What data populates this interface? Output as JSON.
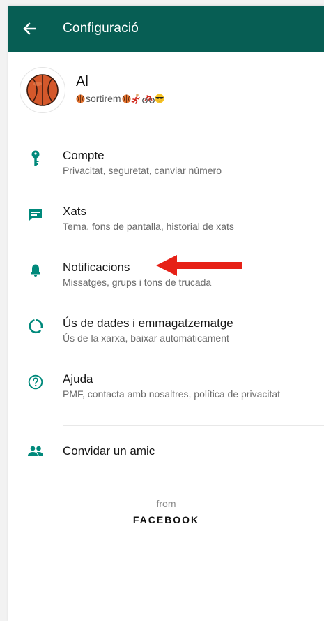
{
  "appbar": {
    "title": "Configuració",
    "color": "#075e54"
  },
  "profile": {
    "name": "Al",
    "status_text": "sortirem",
    "avatar_icon": "basketball-icon"
  },
  "menu": [
    {
      "title": "Compte",
      "subtitle": "Privacitat, seguretat, canviar número",
      "icon": "key-icon"
    },
    {
      "title": "Xats",
      "subtitle": "Tema, fons de pantalla, historial de xats",
      "icon": "chat-icon"
    },
    {
      "title": "Notificacions",
      "subtitle": "Missatges, grups i tons de trucada",
      "icon": "bell-icon"
    },
    {
      "title": "Ús de dades i emmagatzematge",
      "subtitle": "Ús de la xarxa, baixar automàticament",
      "icon": "data-usage-icon"
    },
    {
      "title": "Ajuda",
      "subtitle": "PMF, contacta amb nosaltres, política de privacitat",
      "icon": "help-icon"
    }
  ],
  "invite": {
    "label": "Convidar un amic",
    "icon": "people-icon"
  },
  "footer": {
    "from": "from",
    "brand": "FACEBOOK"
  },
  "accent_color": "#00897b",
  "annotation_arrow_color": "#e62117"
}
